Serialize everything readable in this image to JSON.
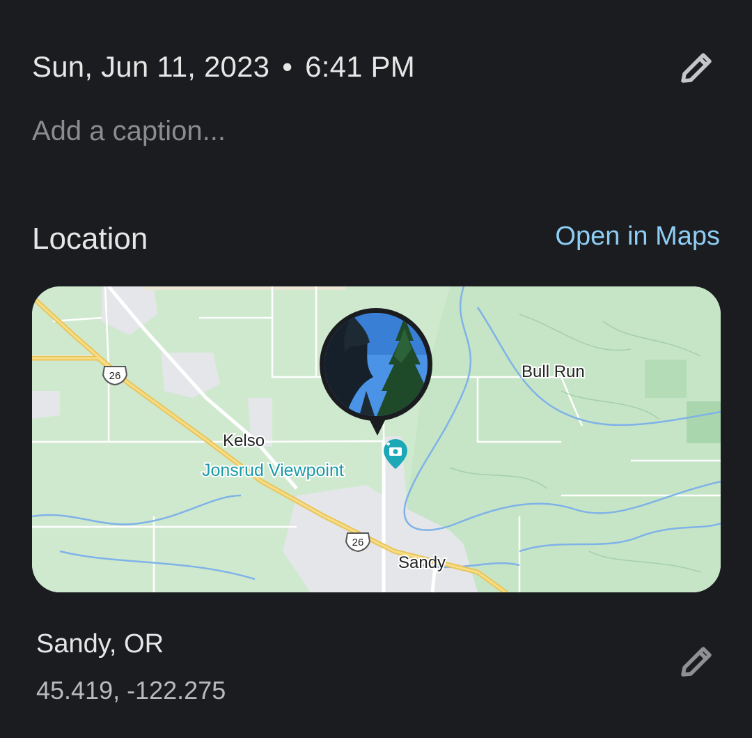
{
  "header": {
    "date": "Sun, Jun 11, 2023",
    "separator": "•",
    "time": "6:41 PM",
    "edit_icon": "pencil-icon"
  },
  "caption": {
    "placeholder": "Add a caption..."
  },
  "location": {
    "title": "Location",
    "open_maps_label": "Open in Maps",
    "map": {
      "labels": {
        "kelso": "Kelso",
        "viewpoint": "Jonsrud Viewpoint",
        "bull_run": "Bull Run",
        "sandy": "Sandy",
        "route_1": "26",
        "route_2": "26"
      },
      "pin_icon": "photo-pin-icon",
      "viewpoint_icon": "camera-poi-icon"
    },
    "place_name": "Sandy, OR",
    "coordinates": "45.419, -122.275",
    "edit_icon": "pencil-icon"
  },
  "colors": {
    "background": "#1b1c1f",
    "accent_link": "#8ecdf4",
    "map_green": "#cde9cd",
    "highway": "#f3d36b",
    "water": "#6fa9e6",
    "poi": "#19a6b5"
  }
}
